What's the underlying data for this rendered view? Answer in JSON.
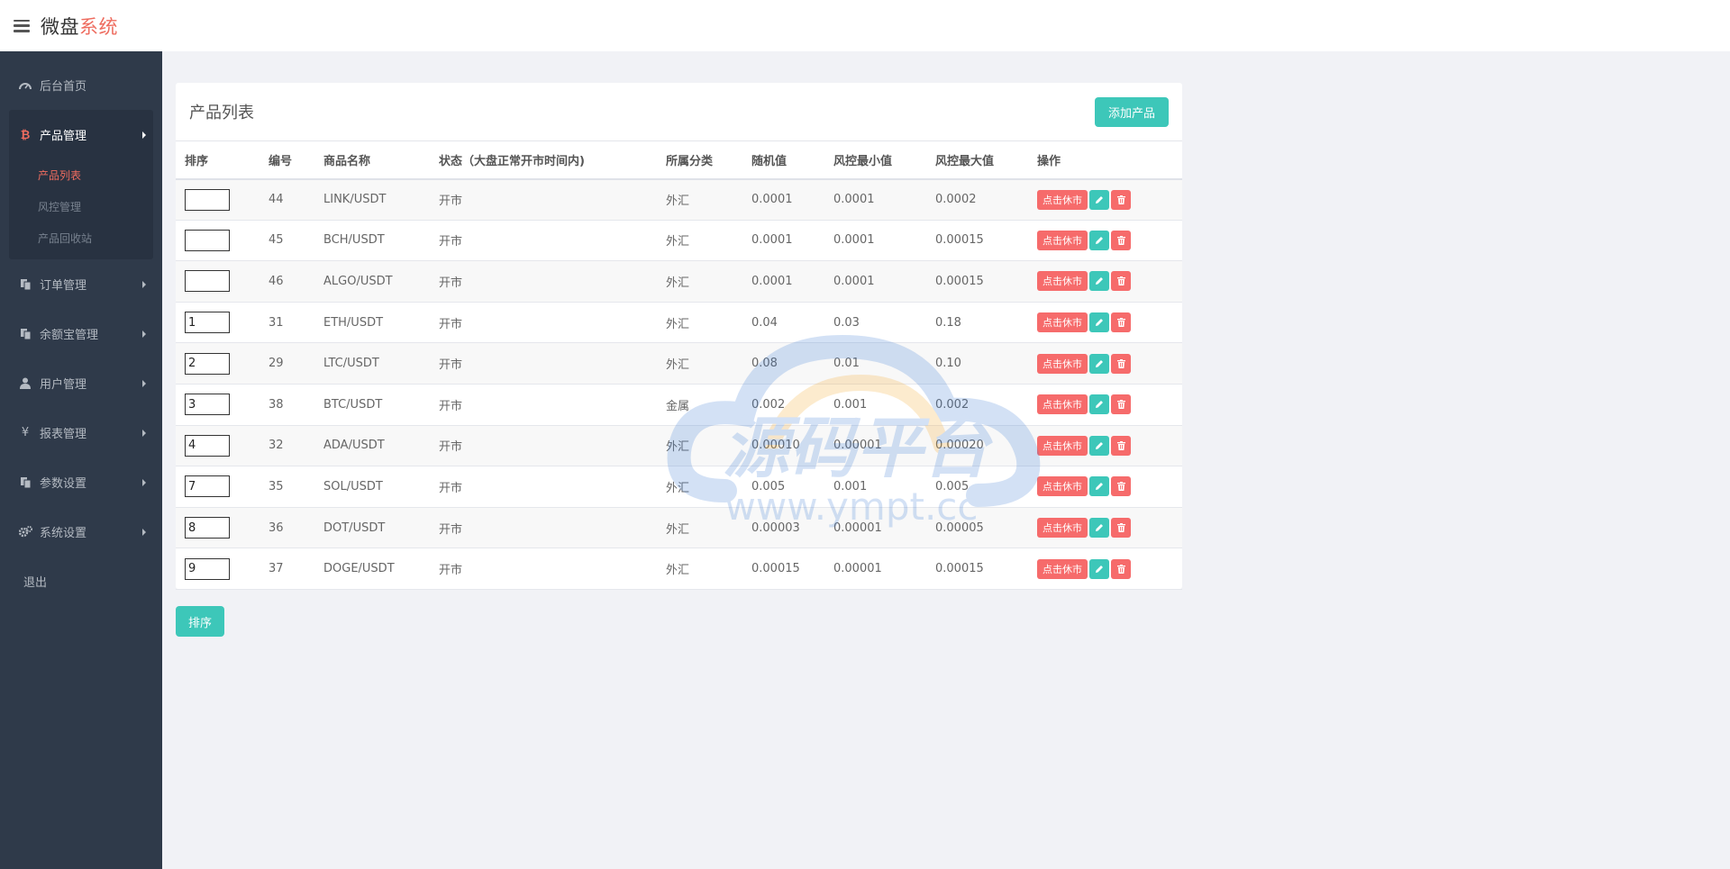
{
  "header": {
    "brand_part1": "微盘",
    "brand_part2": "系统"
  },
  "sidebar": {
    "items": [
      {
        "label": "后台首页",
        "icon": "dashboard-icon"
      },
      {
        "label": "产品管理",
        "icon": "bitcoin-icon",
        "expanded": true,
        "children": [
          {
            "label": "产品列表",
            "active": true
          },
          {
            "label": "风控管理"
          },
          {
            "label": "产品回收站"
          }
        ]
      },
      {
        "label": "订单管理",
        "icon": "copy-icon"
      },
      {
        "label": "余额宝管理",
        "icon": "copy-icon"
      },
      {
        "label": "用户管理",
        "icon": "user-icon"
      },
      {
        "label": "报表管理",
        "icon": "yen-icon"
      },
      {
        "label": "参数设置",
        "icon": "copy-icon"
      },
      {
        "label": "系统设置",
        "icon": "gears-icon"
      }
    ],
    "logout": "退出"
  },
  "main": {
    "title": "产品列表",
    "add_button": "添加产品",
    "sort_button": "排序",
    "columns": [
      "排序",
      "编号",
      "商品名称",
      "状态（大盘正常开市时间内)",
      "所属分类",
      "随机值",
      "风控最小值",
      "风控最大值",
      "操作"
    ],
    "action_label": "点击休市",
    "rows": [
      {
        "sort": "",
        "id": "44",
        "name": "LINK/USDT",
        "status": "开市",
        "category": "外汇",
        "random": "0.0001",
        "min": "0.0001",
        "max": "0.0002"
      },
      {
        "sort": "",
        "id": "45",
        "name": "BCH/USDT",
        "status": "开市",
        "category": "外汇",
        "random": "0.0001",
        "min": "0.0001",
        "max": "0.00015"
      },
      {
        "sort": "",
        "id": "46",
        "name": "ALGO/USDT",
        "status": "开市",
        "category": "外汇",
        "random": "0.0001",
        "min": "0.0001",
        "max": "0.00015"
      },
      {
        "sort": "1",
        "id": "31",
        "name": "ETH/USDT",
        "status": "开市",
        "category": "外汇",
        "random": "0.04",
        "min": "0.03",
        "max": "0.18"
      },
      {
        "sort": "2",
        "id": "29",
        "name": "LTC/USDT",
        "status": "开市",
        "category": "外汇",
        "random": "0.08",
        "min": "0.01",
        "max": "0.10"
      },
      {
        "sort": "3",
        "id": "38",
        "name": "BTC/USDT",
        "status": "开市",
        "category": "金属",
        "random": "0.002",
        "min": "0.001",
        "max": "0.002"
      },
      {
        "sort": "4",
        "id": "32",
        "name": "ADA/USDT",
        "status": "开市",
        "category": "外汇",
        "random": "0.00010",
        "min": "0.00001",
        "max": "0.00020"
      },
      {
        "sort": "7",
        "id": "35",
        "name": "SOL/USDT",
        "status": "开市",
        "category": "外汇",
        "random": "0.005",
        "min": "0.001",
        "max": "0.005"
      },
      {
        "sort": "8",
        "id": "36",
        "name": "DOT/USDT",
        "status": "开市",
        "category": "外汇",
        "random": "0.00003",
        "min": "0.00001",
        "max": "0.00005"
      },
      {
        "sort": "9",
        "id": "37",
        "name": "DOGE/USDT",
        "status": "开市",
        "category": "外汇",
        "random": "0.00015",
        "min": "0.00001",
        "max": "0.00015"
      }
    ]
  },
  "watermark": {
    "title": "源码平台",
    "url": "www.ympt.cc"
  },
  "colors": {
    "sidebar_bg": "#2f3a4a",
    "accent_red": "#ee6c5f",
    "teal": "#3dc7b9",
    "danger": "#f66b6b"
  }
}
